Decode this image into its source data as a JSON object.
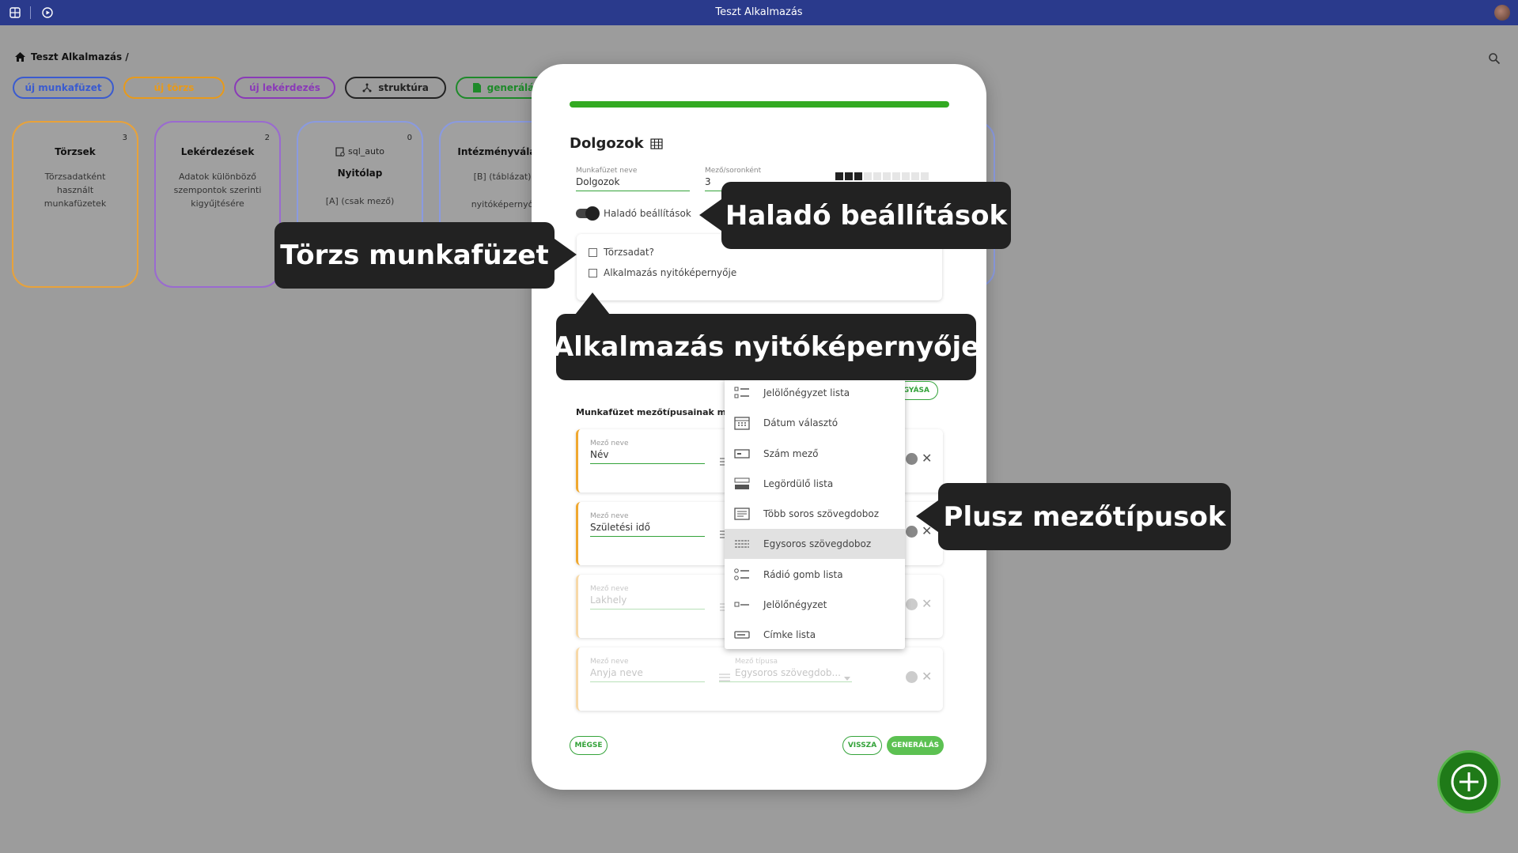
{
  "window": {
    "title": "Teszt Alkalmazás"
  },
  "breadcrumb": {
    "text": "Teszt Alkalmazás /"
  },
  "toolbar": {
    "new_workbook": "új munkafüzet",
    "new_master": "új törzs",
    "new_query": "új lekérdezés",
    "structure": "struktúra",
    "generate": "generálás"
  },
  "cards": [
    {
      "title": "Törzsek",
      "count": "3",
      "desc": "Törzsadatként használt munkafüzetek"
    },
    {
      "title": "Lekérdezések",
      "count": "2",
      "desc": "Adatok különböző szempontok szerinti kigyűjtésére"
    },
    {
      "title_top": "sql_auto",
      "title": "Nyitólap",
      "count": "0",
      "desc": "[A] (csak mező)"
    },
    {
      "title": "Intézményválasz",
      "desc": "[B] (táblázat)",
      "desc2": "nyitóképernyő"
    }
  ],
  "modal": {
    "title": "Dolgozok",
    "workbook_name_label": "Munkafüzet neve",
    "workbook_name_value": "Dolgozok",
    "fields_per_row_label": "Mező/soronként",
    "fields_per_row_value": "3",
    "fields_per_row_level": 3,
    "fields_per_row_max": 10,
    "advanced_toggle_label": "Haladó beállítások",
    "master_checkbox_label": "Törzsadat?",
    "home_checkbox_label": "Alkalmazás nyitóképernyője",
    "section_title": "Munkafüzet mezőtípusainak megha",
    "add_button_partial": "GYÁSA",
    "field_rows": [
      {
        "label": "Mező neve",
        "value": "Név"
      },
      {
        "label": "Mező neve",
        "value": "Születési idő"
      },
      {
        "label": "Mező neve",
        "value": "Lakhely"
      },
      {
        "label": "Mező neve",
        "value": "Anyja neve",
        "type_label": "Mező típusa",
        "type_value": "Egysoros szövegdob..."
      }
    ],
    "cancel": "MÉGSE",
    "back": "VISSZA",
    "generate": "GENERÁLÁS"
  },
  "dropdown": {
    "items": [
      {
        "label": "Jelölőnégyzet lista",
        "icon": "checklist-icon"
      },
      {
        "label": "Dátum választó",
        "icon": "calendar-icon"
      },
      {
        "label": "Szám mező",
        "icon": "number-field-icon"
      },
      {
        "label": "Legördülő lista",
        "icon": "dropdown-list-icon"
      },
      {
        "label": "Több soros szövegdoboz",
        "icon": "multiline-text-icon"
      },
      {
        "label": "Egysoros szövegdoboz",
        "icon": "singleline-text-icon",
        "selected": true
      },
      {
        "label": "Rádió gomb lista",
        "icon": "radio-list-icon"
      },
      {
        "label": "Jelölőnégyzet",
        "icon": "checkbox-icon"
      },
      {
        "label": "Címke lista",
        "icon": "label-list-icon"
      }
    ]
  },
  "callouts": {
    "advanced": "Haladó beállítások",
    "master": "Törzs munkafüzet",
    "home": "Alkalmazás nyitóképernyője",
    "types": "Plusz mezőtípusok"
  },
  "colors": {
    "topbar": "#2a3a8c",
    "accent_green": "#34a33a",
    "workbook_blue": "#3a5bd0",
    "master_orange": "#e89a1a",
    "query_purple": "#8a3ab8"
  }
}
